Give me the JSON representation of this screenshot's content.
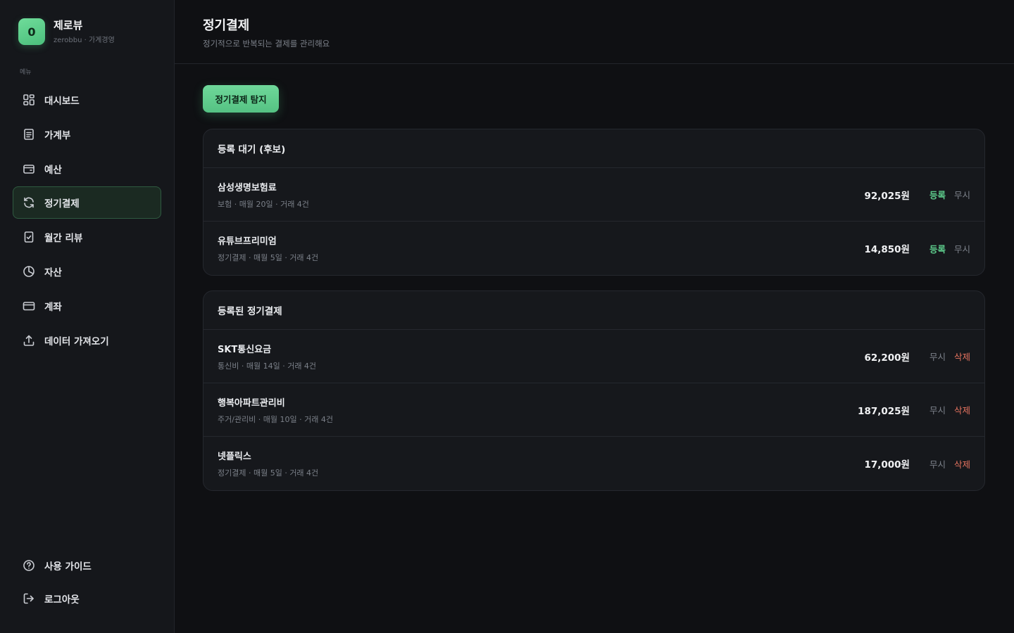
{
  "brand": {
    "initial": "0",
    "name": "제로뷰",
    "subtitle": "zerobbu · 가계경영"
  },
  "sidebar": {
    "caption": "메뉴",
    "items": [
      {
        "label": "대시보드",
        "icon": "grid-icon"
      },
      {
        "label": "가계부",
        "icon": "document-icon"
      },
      {
        "label": "예산",
        "icon": "wallet-icon"
      },
      {
        "label": "정기결제",
        "icon": "refresh-icon",
        "active": true
      },
      {
        "label": "월간 리뷰",
        "icon": "checklist-icon"
      },
      {
        "label": "자산",
        "icon": "pie-chart-icon"
      },
      {
        "label": "계좌",
        "icon": "card-icon"
      },
      {
        "label": "데이터 가져오기",
        "icon": "upload-icon"
      }
    ],
    "bottom": [
      {
        "label": "사용 가이드",
        "icon": "help-icon"
      },
      {
        "label": "로그아웃",
        "icon": "logout-icon"
      }
    ]
  },
  "header": {
    "title": "정기결제",
    "subtitle": "정기적으로 반복되는 결제를 관리해요"
  },
  "detect_button": "정기결제 탐지",
  "pending": {
    "title": "등록 대기 (후보)",
    "actions": {
      "primary": "등록",
      "secondary": "무시"
    },
    "rows": [
      {
        "name": "삼성생명보험료",
        "meta": "보험 · 매월 20일 · 거래 4건",
        "amount": "92,025원"
      },
      {
        "name": "유튜브프리미엄",
        "meta": "정기결제 · 매월 5일 · 거래 4건",
        "amount": "14,850원"
      }
    ]
  },
  "registered": {
    "title": "등록된 정기결제",
    "actions": {
      "primary": "무시",
      "secondary": "삭제"
    },
    "rows": [
      {
        "name": "SKT통신요금",
        "meta": "통신비 · 매월 14일 · 거래 4건",
        "amount": "62,200원"
      },
      {
        "name": "행복아파트관리비",
        "meta": "주거/관리비 · 매월 10일 · 거래 4건",
        "amount": "187,025원"
      },
      {
        "name": "넷플릭스",
        "meta": "정기결제 · 매월 5일 · 거래 4건",
        "amount": "17,000원"
      }
    ]
  },
  "colors": {
    "accent": "#5cc98a",
    "danger": "#e5735f",
    "background": "#0f1013",
    "sidebar": "#15171b"
  }
}
